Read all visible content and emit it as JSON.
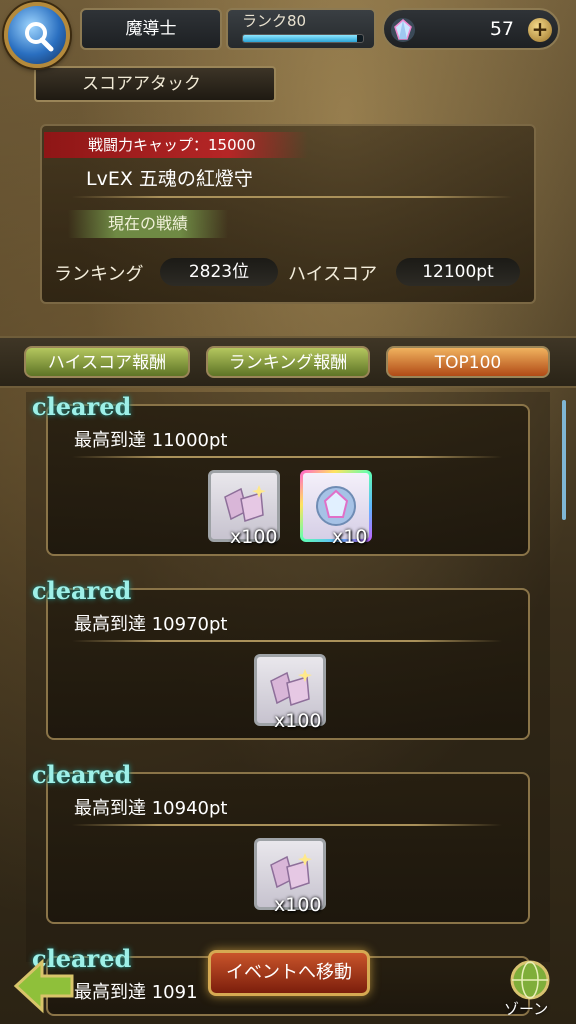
{
  "header": {
    "class_name": "魔導士",
    "rank_label": "ランク80",
    "rank_progress": 0.95,
    "gem_count": "57",
    "plus_label": "+",
    "menu_icon": "magnifier-icon",
    "gem_icon": "crystal-icon"
  },
  "score_attack": {
    "title": "スコアアタック",
    "cap_badge": "戦闘力キャップ：15000",
    "stage_name": "LvEX 五魂の紅燈守",
    "record_tab": "現在の戦績",
    "ranking_label": "ランキング",
    "ranking_value": "2823位",
    "highscore_label": "ハイスコア",
    "highscore_value": "12100pt"
  },
  "tabs": [
    {
      "label": "ハイスコア報酬",
      "color": "#7d9233"
    },
    {
      "label": "ランキング報酬",
      "color": "#7d9233"
    },
    {
      "label": "TOP100",
      "color": "#c8611f"
    }
  ],
  "rewards": [
    {
      "status": "cleared",
      "description": "最高到達 11000pt",
      "items": [
        {
          "icon": "crystal-shards-icon",
          "quantity": "x100"
        },
        {
          "icon": "rainbow-gem-icon",
          "quantity": "x10"
        }
      ]
    },
    {
      "status": "cleared",
      "description": "最高到達 10970pt",
      "items": [
        {
          "icon": "crystal-shards-icon",
          "quantity": "x100"
        }
      ]
    },
    {
      "status": "cleared",
      "description": "最高到達 10940pt",
      "items": [
        {
          "icon": "crystal-shards-icon",
          "quantity": "x100"
        }
      ]
    },
    {
      "status": "cleared",
      "description": "最高到達 1091",
      "items": []
    }
  ],
  "footer": {
    "back_icon": "back-arrow-icon",
    "event_button": "イベントへ移動",
    "zone_label": "ゾーン",
    "zone_icon": "globe-icon"
  }
}
